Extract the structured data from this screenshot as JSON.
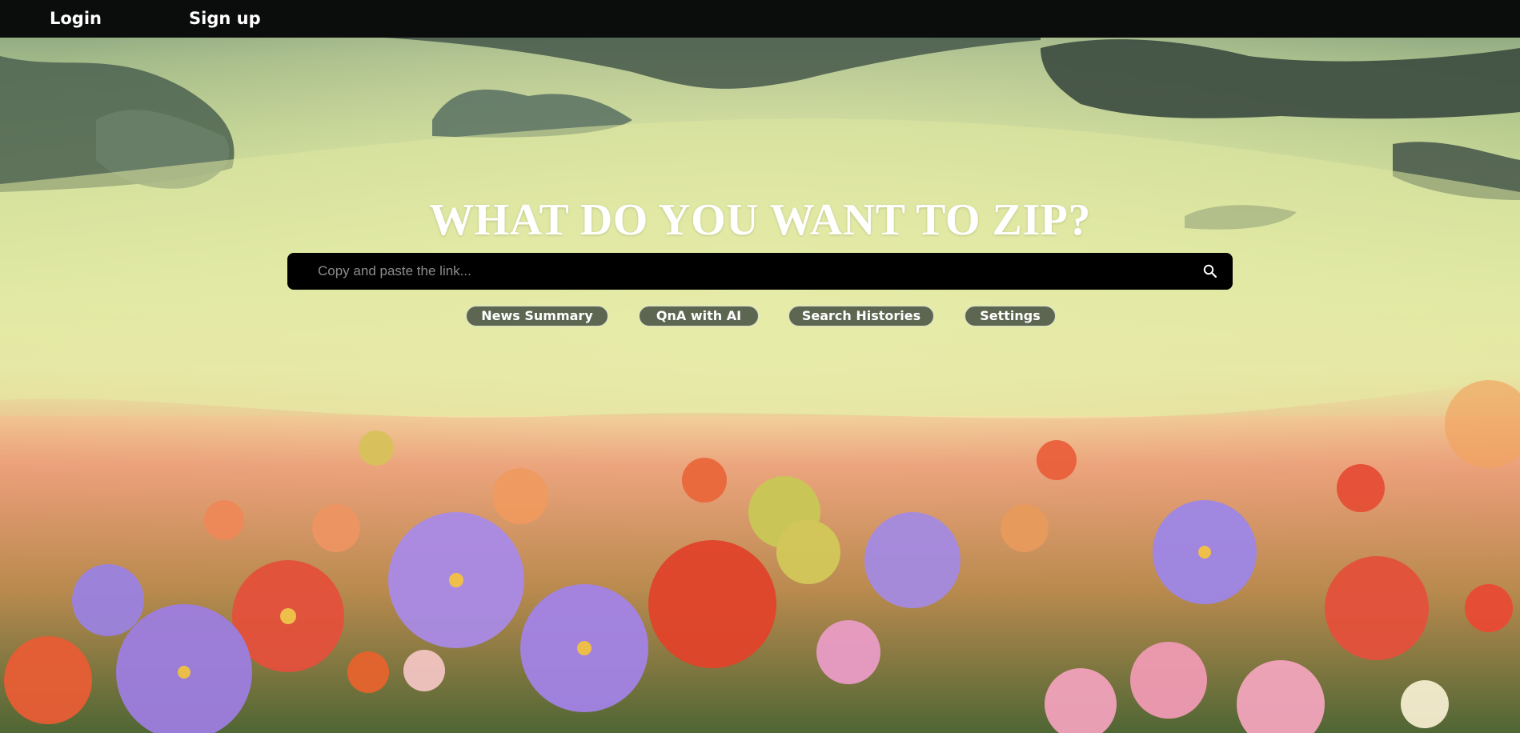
{
  "nav": {
    "login_label": "Login",
    "signup_label": "Sign up"
  },
  "hero": {
    "title": "WHAT DO YOU WANT TO ZIP?"
  },
  "search": {
    "placeholder": "Copy and paste the link...",
    "value": "",
    "icon": "search-icon"
  },
  "menu": {
    "items": [
      {
        "label": "News Summary"
      },
      {
        "label": "QnA with AI"
      },
      {
        "label": "Search Histories"
      },
      {
        "label": "Settings"
      }
    ]
  },
  "colors": {
    "topbar": "#0b0d0c",
    "search_bar": "#000000",
    "pill_bg": "#5d6650",
    "pill_border": "#d9dfcf",
    "title_text": "#ffffff"
  }
}
